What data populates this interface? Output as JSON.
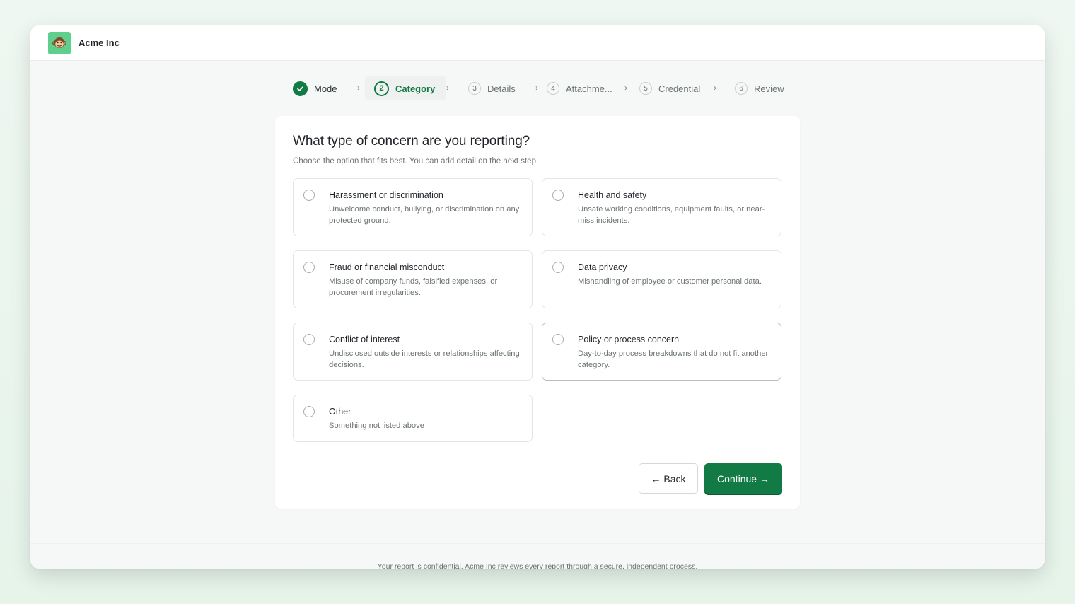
{
  "header": {
    "company_name": "Acme Inc",
    "logo_icon": "monkey-icon"
  },
  "steps": [
    {
      "number": "1",
      "label": "Mode",
      "state": "done"
    },
    {
      "number": "2",
      "label": "Category",
      "state": "active"
    },
    {
      "number": "3",
      "label": "Details",
      "state": "upcoming"
    },
    {
      "number": "4",
      "label": "Attachme...",
      "state": "upcoming"
    },
    {
      "number": "5",
      "label": "Credential",
      "state": "upcoming"
    },
    {
      "number": "6",
      "label": "Review",
      "state": "upcoming"
    }
  ],
  "card": {
    "title": "What type of concern are you reporting?",
    "subtitle": "Choose the option that fits best. You can add detail on the next step.",
    "options": [
      {
        "title": "Harassment or discrimination",
        "description": "Unwelcome conduct, bullying, or discrimination on any protected ground."
      },
      {
        "title": "Health and safety",
        "description": "Unsafe working conditions, equipment faults, or near-miss incidents."
      },
      {
        "title": "Fraud or financial misconduct",
        "description": "Misuse of company funds, falsified expenses, or procurement irregularities."
      },
      {
        "title": "Data privacy",
        "description": "Mishandling of employee or customer personal data."
      },
      {
        "title": "Conflict of interest",
        "description": "Undisclosed outside interests or relationships affecting decisions."
      },
      {
        "title": "Policy or process concern",
        "description": "Day-to-day process breakdowns that do not fit another category."
      },
      {
        "title": "Other",
        "description": "Something not listed above"
      }
    ],
    "back_label": "← Back",
    "continue_label": "Continue →"
  },
  "footer": {
    "text": "Your report is confidential. Acme Inc reviews every report through a secure, independent process."
  },
  "colors": {
    "accent": "#127a44",
    "logo_bg": "#5fcf8d"
  }
}
